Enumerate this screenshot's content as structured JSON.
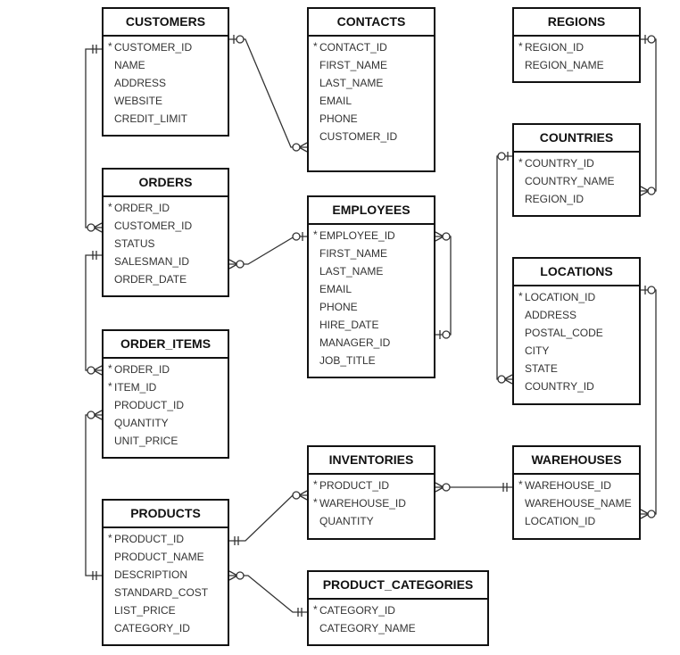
{
  "tables": {
    "customers": {
      "name": "CUSTOMERS",
      "columns": [
        {
          "name": "CUSTOMER_ID",
          "pk": true
        },
        {
          "name": "NAME"
        },
        {
          "name": "ADDRESS"
        },
        {
          "name": "WEBSITE"
        },
        {
          "name": "CREDIT_LIMIT"
        }
      ]
    },
    "contacts": {
      "name": "CONTACTS",
      "columns": [
        {
          "name": "CONTACT_ID",
          "pk": true
        },
        {
          "name": "FIRST_NAME"
        },
        {
          "name": "LAST_NAME"
        },
        {
          "name": "EMAIL"
        },
        {
          "name": "PHONE"
        },
        {
          "name": "CUSTOMER_ID"
        }
      ]
    },
    "regions": {
      "name": "REGIONS",
      "columns": [
        {
          "name": "REGION_ID",
          "pk": true
        },
        {
          "name": "REGION_NAME"
        }
      ]
    },
    "countries": {
      "name": "COUNTRIES",
      "columns": [
        {
          "name": "COUNTRY_ID",
          "pk": true
        },
        {
          "name": "COUNTRY_NAME"
        },
        {
          "name": "REGION_ID"
        }
      ]
    },
    "orders": {
      "name": "ORDERS",
      "columns": [
        {
          "name": "ORDER_ID",
          "pk": true
        },
        {
          "name": "CUSTOMER_ID"
        },
        {
          "name": "STATUS"
        },
        {
          "name": "SALESMAN_ID"
        },
        {
          "name": "ORDER_DATE"
        }
      ]
    },
    "employees": {
      "name": "EMPLOYEES",
      "columns": [
        {
          "name": "EMPLOYEE_ID",
          "pk": true
        },
        {
          "name": "FIRST_NAME"
        },
        {
          "name": "LAST_NAME"
        },
        {
          "name": "EMAIL"
        },
        {
          "name": "PHONE"
        },
        {
          "name": "HIRE_DATE"
        },
        {
          "name": "MANAGER_ID"
        },
        {
          "name": "JOB_TITLE"
        }
      ]
    },
    "locations": {
      "name": "LOCATIONS",
      "columns": [
        {
          "name": "LOCATION_ID",
          "pk": true
        },
        {
          "name": "ADDRESS"
        },
        {
          "name": "POSTAL_CODE"
        },
        {
          "name": "CITY"
        },
        {
          "name": "STATE"
        },
        {
          "name": "COUNTRY_ID"
        }
      ]
    },
    "order_items": {
      "name": "ORDER_ITEMS",
      "columns": [
        {
          "name": "ORDER_ID",
          "pk": true
        },
        {
          "name": "ITEM_ID",
          "pk": true
        },
        {
          "name": "PRODUCT_ID"
        },
        {
          "name": "QUANTITY"
        },
        {
          "name": "UNIT_PRICE"
        }
      ]
    },
    "inventories": {
      "name": "INVENTORIES",
      "columns": [
        {
          "name": "PRODUCT_ID",
          "pk": true
        },
        {
          "name": "WAREHOUSE_ID",
          "pk": true
        },
        {
          "name": "QUANTITY"
        }
      ]
    },
    "warehouses": {
      "name": "WAREHOUSES",
      "columns": [
        {
          "name": "WAREHOUSE_ID",
          "pk": true
        },
        {
          "name": "WAREHOUSE_NAME"
        },
        {
          "name": "LOCATION_ID"
        }
      ]
    },
    "products": {
      "name": "PRODUCTS",
      "columns": [
        {
          "name": "PRODUCT_ID",
          "pk": true
        },
        {
          "name": "PRODUCT_NAME"
        },
        {
          "name": "DESCRIPTION"
        },
        {
          "name": "STANDARD_COST"
        },
        {
          "name": "LIST_PRICE"
        },
        {
          "name": "CATEGORY_ID"
        }
      ]
    },
    "product_categories": {
      "name": "PRODUCT_CATEGORIES",
      "columns": [
        {
          "name": "CATEGORY_ID",
          "pk": true
        },
        {
          "name": "CATEGORY_NAME"
        }
      ]
    }
  },
  "pk_marker": "*"
}
